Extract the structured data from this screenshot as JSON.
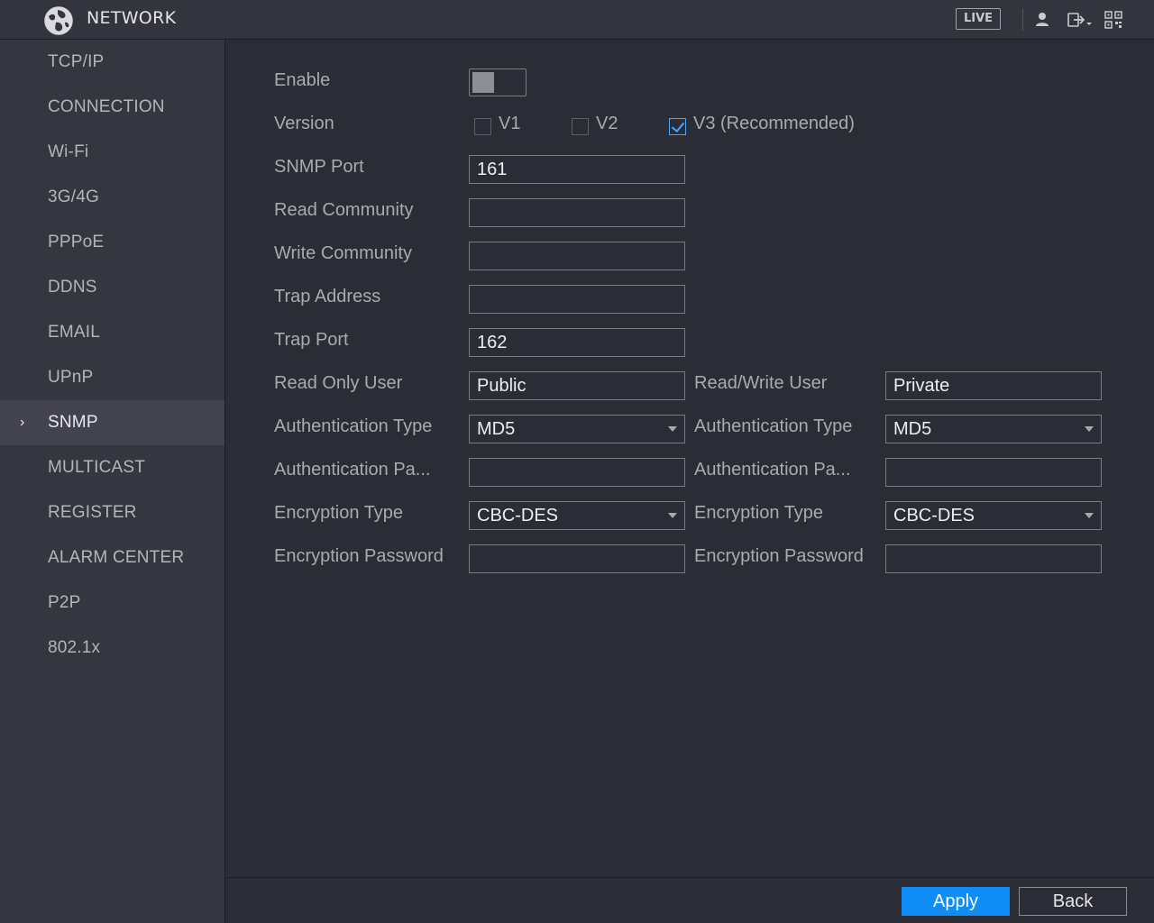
{
  "header": {
    "title": "NETWORK",
    "live_label": "LIVE",
    "icons": [
      "logo-globe-icon",
      "user-icon",
      "logout-icon",
      "qr-code-icon"
    ]
  },
  "sidebar": {
    "items": [
      {
        "label": "TCP/IP",
        "active": false
      },
      {
        "label": "CONNECTION",
        "active": false
      },
      {
        "label": "Wi-Fi",
        "active": false
      },
      {
        "label": "3G/4G",
        "active": false
      },
      {
        "label": "PPPoE",
        "active": false
      },
      {
        "label": "DDNS",
        "active": false
      },
      {
        "label": "EMAIL",
        "active": false
      },
      {
        "label": "UPnP",
        "active": false
      },
      {
        "label": "SNMP",
        "active": true
      },
      {
        "label": "MULTICAST",
        "active": false
      },
      {
        "label": "REGISTER",
        "active": false
      },
      {
        "label": "ALARM CENTER",
        "active": false
      },
      {
        "label": "P2P",
        "active": false
      },
      {
        "label": "802.1x",
        "active": false
      }
    ],
    "active_chevron": "›"
  },
  "form": {
    "enable": {
      "label": "Enable",
      "on": false
    },
    "version": {
      "label": "Version",
      "options": [
        {
          "label": "V1",
          "checked": false
        },
        {
          "label": "V2",
          "checked": false
        },
        {
          "label": "V3 (Recommended)",
          "checked": true
        }
      ]
    },
    "snmp_port": {
      "label": "SNMP Port",
      "value": "161"
    },
    "read_community": {
      "label": "Read Community",
      "value": ""
    },
    "write_community": {
      "label": "Write Community",
      "value": ""
    },
    "trap_address": {
      "label": "Trap Address",
      "value": ""
    },
    "trap_port": {
      "label": "Trap Port",
      "value": "162"
    },
    "read_only": {
      "user_label": "Read Only User",
      "user": "Public",
      "auth_type_label": "Authentication Type",
      "auth_type": "MD5",
      "auth_pass_label": "Authentication Pa...",
      "auth_pass": "",
      "enc_type_label": "Encryption Type",
      "enc_type": "CBC-DES",
      "enc_pass_label": "Encryption Password",
      "enc_pass": ""
    },
    "read_write": {
      "user_label": "Read/Write User",
      "user": "Private",
      "auth_type_label": "Authentication Type",
      "auth_type": "MD5",
      "auth_pass_label": "Authentication Pa...",
      "auth_pass": "",
      "enc_type_label": "Encryption Type",
      "enc_type": "CBC-DES",
      "enc_pass_label": "Encryption Password",
      "enc_pass": ""
    }
  },
  "footer": {
    "apply_label": "Apply",
    "back_label": "Back"
  },
  "colors": {
    "accent": "#0f8df5",
    "check": "#4aa3ff",
    "background": "#2b2c35",
    "sidebar": "#353640"
  }
}
